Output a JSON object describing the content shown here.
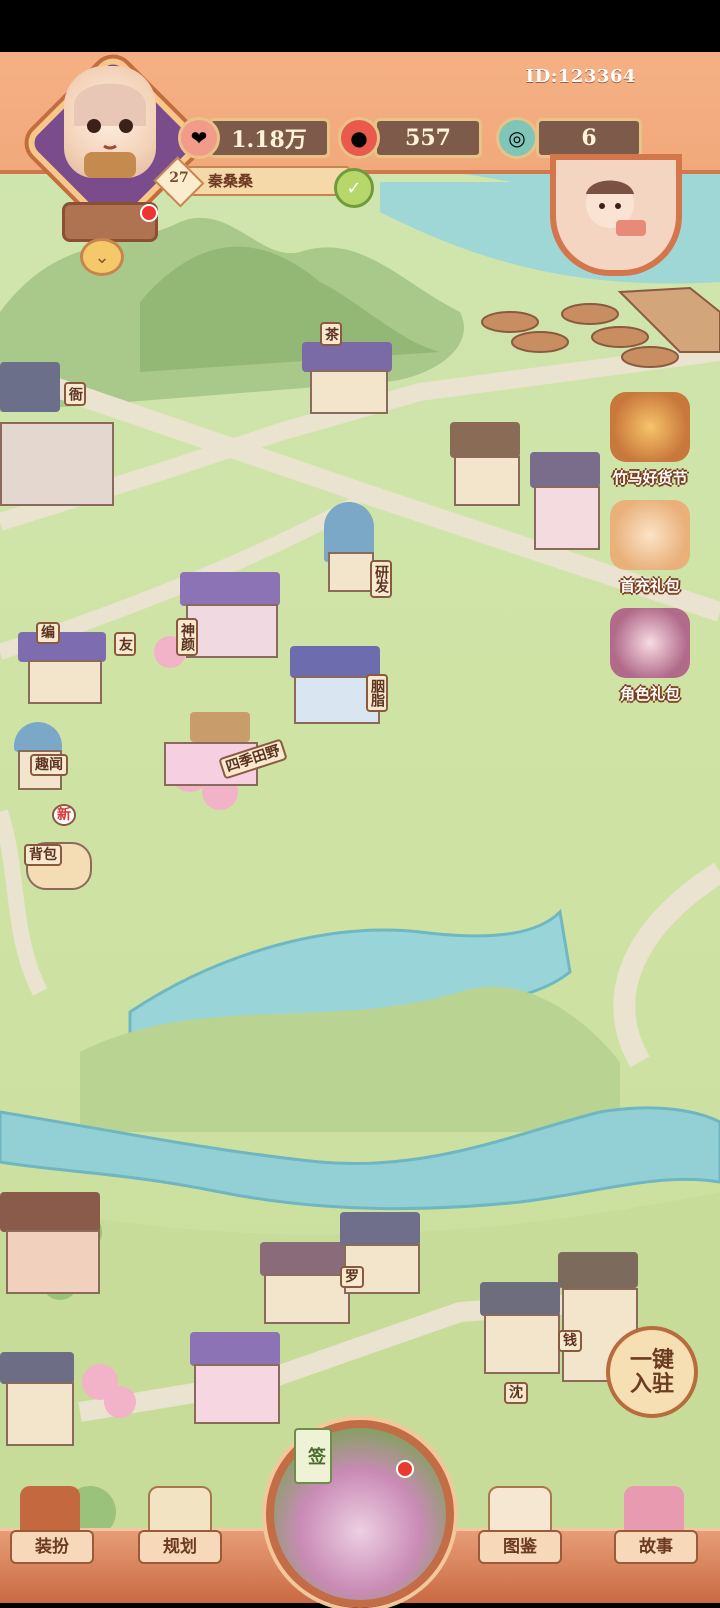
{
  "header": {
    "player_id": "ID:123364",
    "player_level": "27",
    "player_name": "秦桑桑",
    "resources": [
      {
        "name": "coins",
        "icon": "fan-coin-icon",
        "value": "1.18万"
      },
      {
        "name": "gems",
        "icon": "red-gem-icon",
        "value": "557"
      },
      {
        "name": "jade",
        "icon": "jade-ring-icon",
        "value": "6"
      }
    ]
  },
  "events": [
    {
      "label": "竹马好货节",
      "icon": "treasure-chest-icon"
    },
    {
      "label": "首充礼包",
      "icon": "cat-gift-icon"
    },
    {
      "label": "角色礼包",
      "icon": "character-gift-icon"
    }
  ],
  "buildings": {
    "tea": "茶",
    "research": "研发",
    "shenyan": "神颜",
    "rouge": "胭脂",
    "fields": "四季田野",
    "weave": "编",
    "friends": "友",
    "fun": "趣闻",
    "backpack": "背包",
    "new_badge": "新",
    "street_a": "钱",
    "street_b": "沈",
    "street_c": "罗",
    "guard": "衙"
  },
  "onekey_label": "一键入驻",
  "nav": {
    "dress": "装扮",
    "plan": "规划",
    "center_tag": "签",
    "gallery": "图鉴",
    "story": "故事"
  },
  "colors": {
    "hud_orange": "#f1a97b",
    "grass": "#cfe3a5",
    "river": "#8fd0d6",
    "accent_brown": "#6d3b22"
  }
}
